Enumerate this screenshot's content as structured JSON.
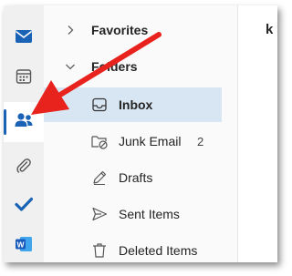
{
  "rail": {
    "items": [
      {
        "icon": "mail-icon"
      },
      {
        "icon": "calendar-icon"
      },
      {
        "icon": "people-icon"
      },
      {
        "icon": "attachment-icon"
      },
      {
        "icon": "todo-icon"
      },
      {
        "icon": "word-icon"
      }
    ],
    "accent": "#1a62b5"
  },
  "folders": {
    "favorites_label": "Favorites",
    "folders_label": "Folders",
    "items": [
      {
        "label": "Inbox",
        "icon": "inbox-icon",
        "count": ""
      },
      {
        "label": "Junk Email",
        "icon": "junk-icon",
        "count": "2"
      },
      {
        "label": "Drafts",
        "icon": "drafts-icon",
        "count": ""
      },
      {
        "label": "Sent Items",
        "icon": "sent-icon",
        "count": ""
      },
      {
        "label": "Deleted Items",
        "icon": "trash-icon",
        "count": ""
      }
    ]
  },
  "right_pane": {
    "partial_text": "k"
  },
  "annotation": {
    "arrow_color": "#e8231d"
  }
}
